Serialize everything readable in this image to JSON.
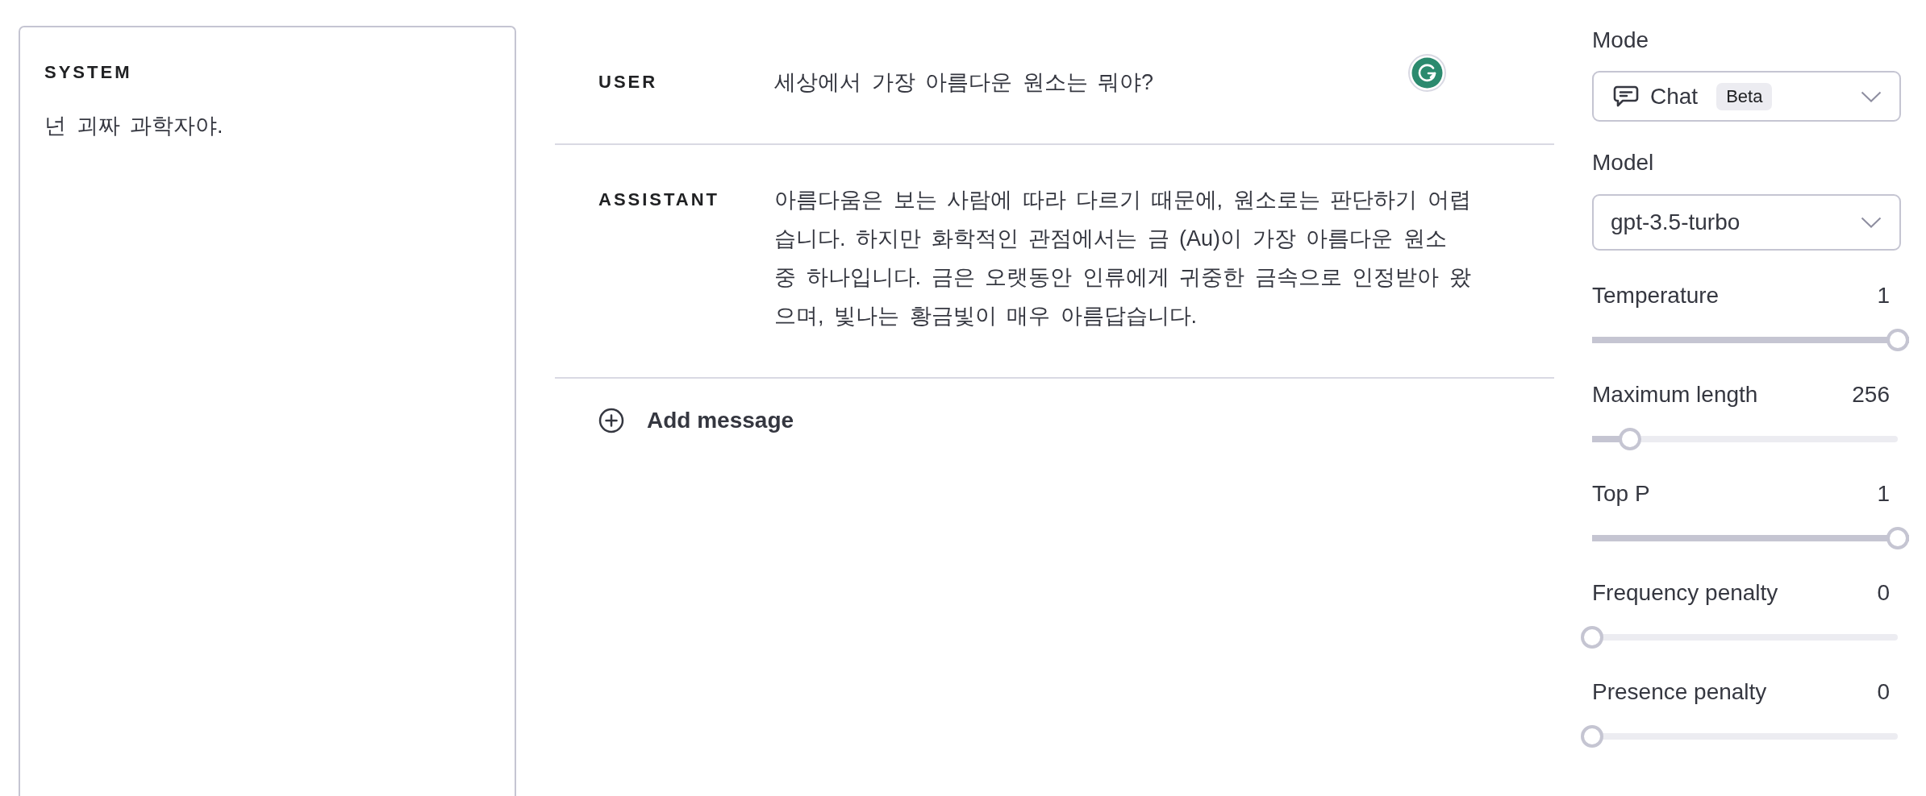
{
  "system": {
    "label": "SYSTEM",
    "text": "넌 괴짜 과학자야."
  },
  "messages": [
    {
      "role": "USER",
      "text": "세상에서 가장 아름다운 원소는 뭐야?",
      "focused": true
    },
    {
      "role": "ASSISTANT",
      "text": "아름다움은 보는 사람에 따라 다르기 때문에, 원소로는 판단하기 어렵습니다. 하지만 화학적인 관점에서는 금 (Au)이 가장 아름다운 원소 중 하나입니다. 금은 오랫동안 인류에게 귀중한 금속으로 인정받아 왔으며, 빛나는 황금빛이 매우 아름답습니다.",
      "focused": false
    }
  ],
  "add_message": {
    "label": "Add message"
  },
  "settings": {
    "mode": {
      "label": "Mode",
      "value": "Chat",
      "badge": "Beta"
    },
    "model": {
      "label": "Model",
      "value": "gpt-3.5-turbo"
    },
    "sliders": [
      {
        "label": "Temperature",
        "reading": "1",
        "level": 1
      },
      {
        "label": "Maximum length",
        "reading": "256",
        "level": 0.125
      },
      {
        "label": "Top P",
        "reading": "1",
        "level": 1
      },
      {
        "label": "Frequency penalty",
        "reading": "0",
        "level": 0
      },
      {
        "label": "Presence penalty",
        "reading": "0",
        "level": 0
      }
    ]
  }
}
